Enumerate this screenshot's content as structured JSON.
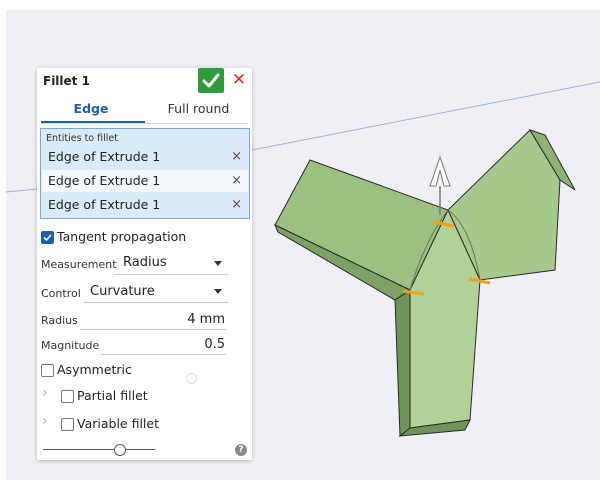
{
  "panel": {
    "title": "Fillet 1",
    "confirm_icon": "check-icon",
    "cancel_icon": "close-icon",
    "cancel_glyph": "✕",
    "tabs": [
      {
        "label": "Edge",
        "active": true
      },
      {
        "label": "Full round",
        "active": false
      }
    ],
    "entities": {
      "label": "Entities to fillet",
      "items": [
        {
          "label": "Edge of Extrude 1",
          "remove": "×"
        },
        {
          "label": "Edge of Extrude 1",
          "remove": "×"
        },
        {
          "label": "Edge of Extrude 1",
          "remove": "×"
        }
      ]
    },
    "tangent_propagation": {
      "label": "Tangent propagation",
      "checked": true
    },
    "measurement": {
      "label": "Measurement",
      "value": "Radius"
    },
    "control": {
      "label": "Control",
      "value": "Curvature"
    },
    "radius": {
      "label": "Radius",
      "value": "4 mm"
    },
    "magnitude": {
      "label": "Magnitude",
      "value": "0.5"
    },
    "asymmetric": {
      "label": "Asymmetric",
      "checked": false
    },
    "partial_fillet": {
      "label": "Partial fillet",
      "checked": false,
      "chevron": "›"
    },
    "variable_fillet": {
      "label": "Variable fillet",
      "checked": false,
      "chevron": "›"
    },
    "help_glyph": "?"
  },
  "colors": {
    "accent": "#1f5ea8",
    "confirm": "#2e9c3a",
    "cancel": "#d9342b",
    "part_fill": "#a8c98d",
    "edge_highlight": "#f0a020",
    "viewport_bg": "#eef0f5"
  }
}
